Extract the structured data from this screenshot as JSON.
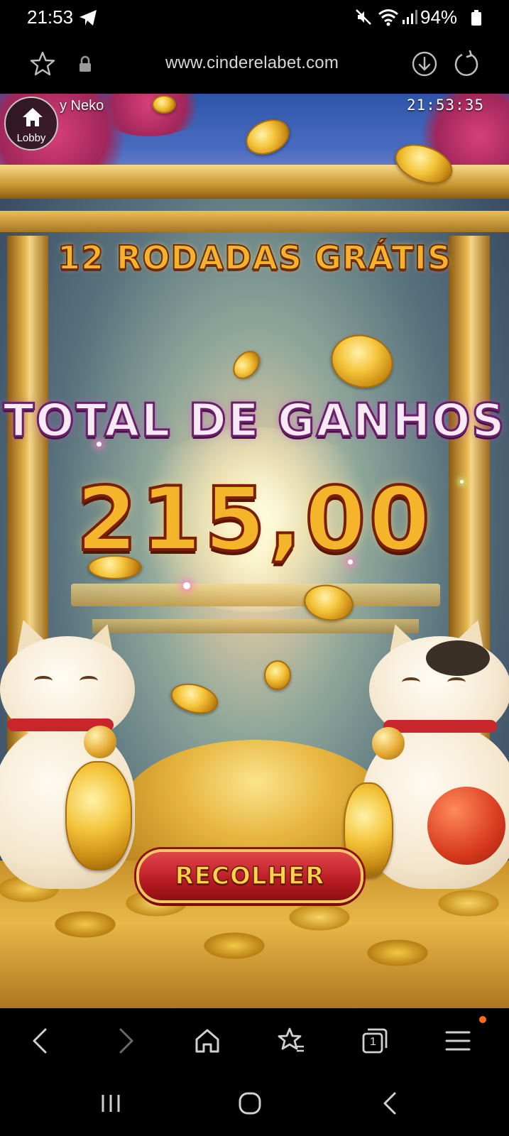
{
  "status_bar": {
    "time": "21:53",
    "battery": "94%",
    "icons": [
      "telegram-icon",
      "mute-icon",
      "wifi-icon",
      "signal-icon",
      "battery-icon"
    ]
  },
  "browser": {
    "url": "www.cinderelabet.com",
    "tab_count": "1",
    "icons": [
      "star-icon",
      "lock-icon",
      "download-icon",
      "reload-icon"
    ]
  },
  "game": {
    "title": "y Neko",
    "clock": "21:53:35",
    "lobby_label": "Lobby",
    "free_spins_text": "12 RODADAS GRÁTIS",
    "total_label": "TOTAL DE GANHOS",
    "total_amount": "215,00",
    "collect_label": "RECOLHER",
    "colors": {
      "gold": "#f4b52a",
      "purple_outline": "#6a1f6a",
      "button_red": "#b81c22"
    }
  },
  "bottom_nav": {
    "items": [
      "back-icon",
      "forward-icon",
      "home-icon",
      "bookmarks-icon",
      "tabs-icon",
      "menu-icon"
    ]
  },
  "system_nav": {
    "items": [
      "recents-icon",
      "home-circle-icon",
      "system-back-icon"
    ]
  }
}
